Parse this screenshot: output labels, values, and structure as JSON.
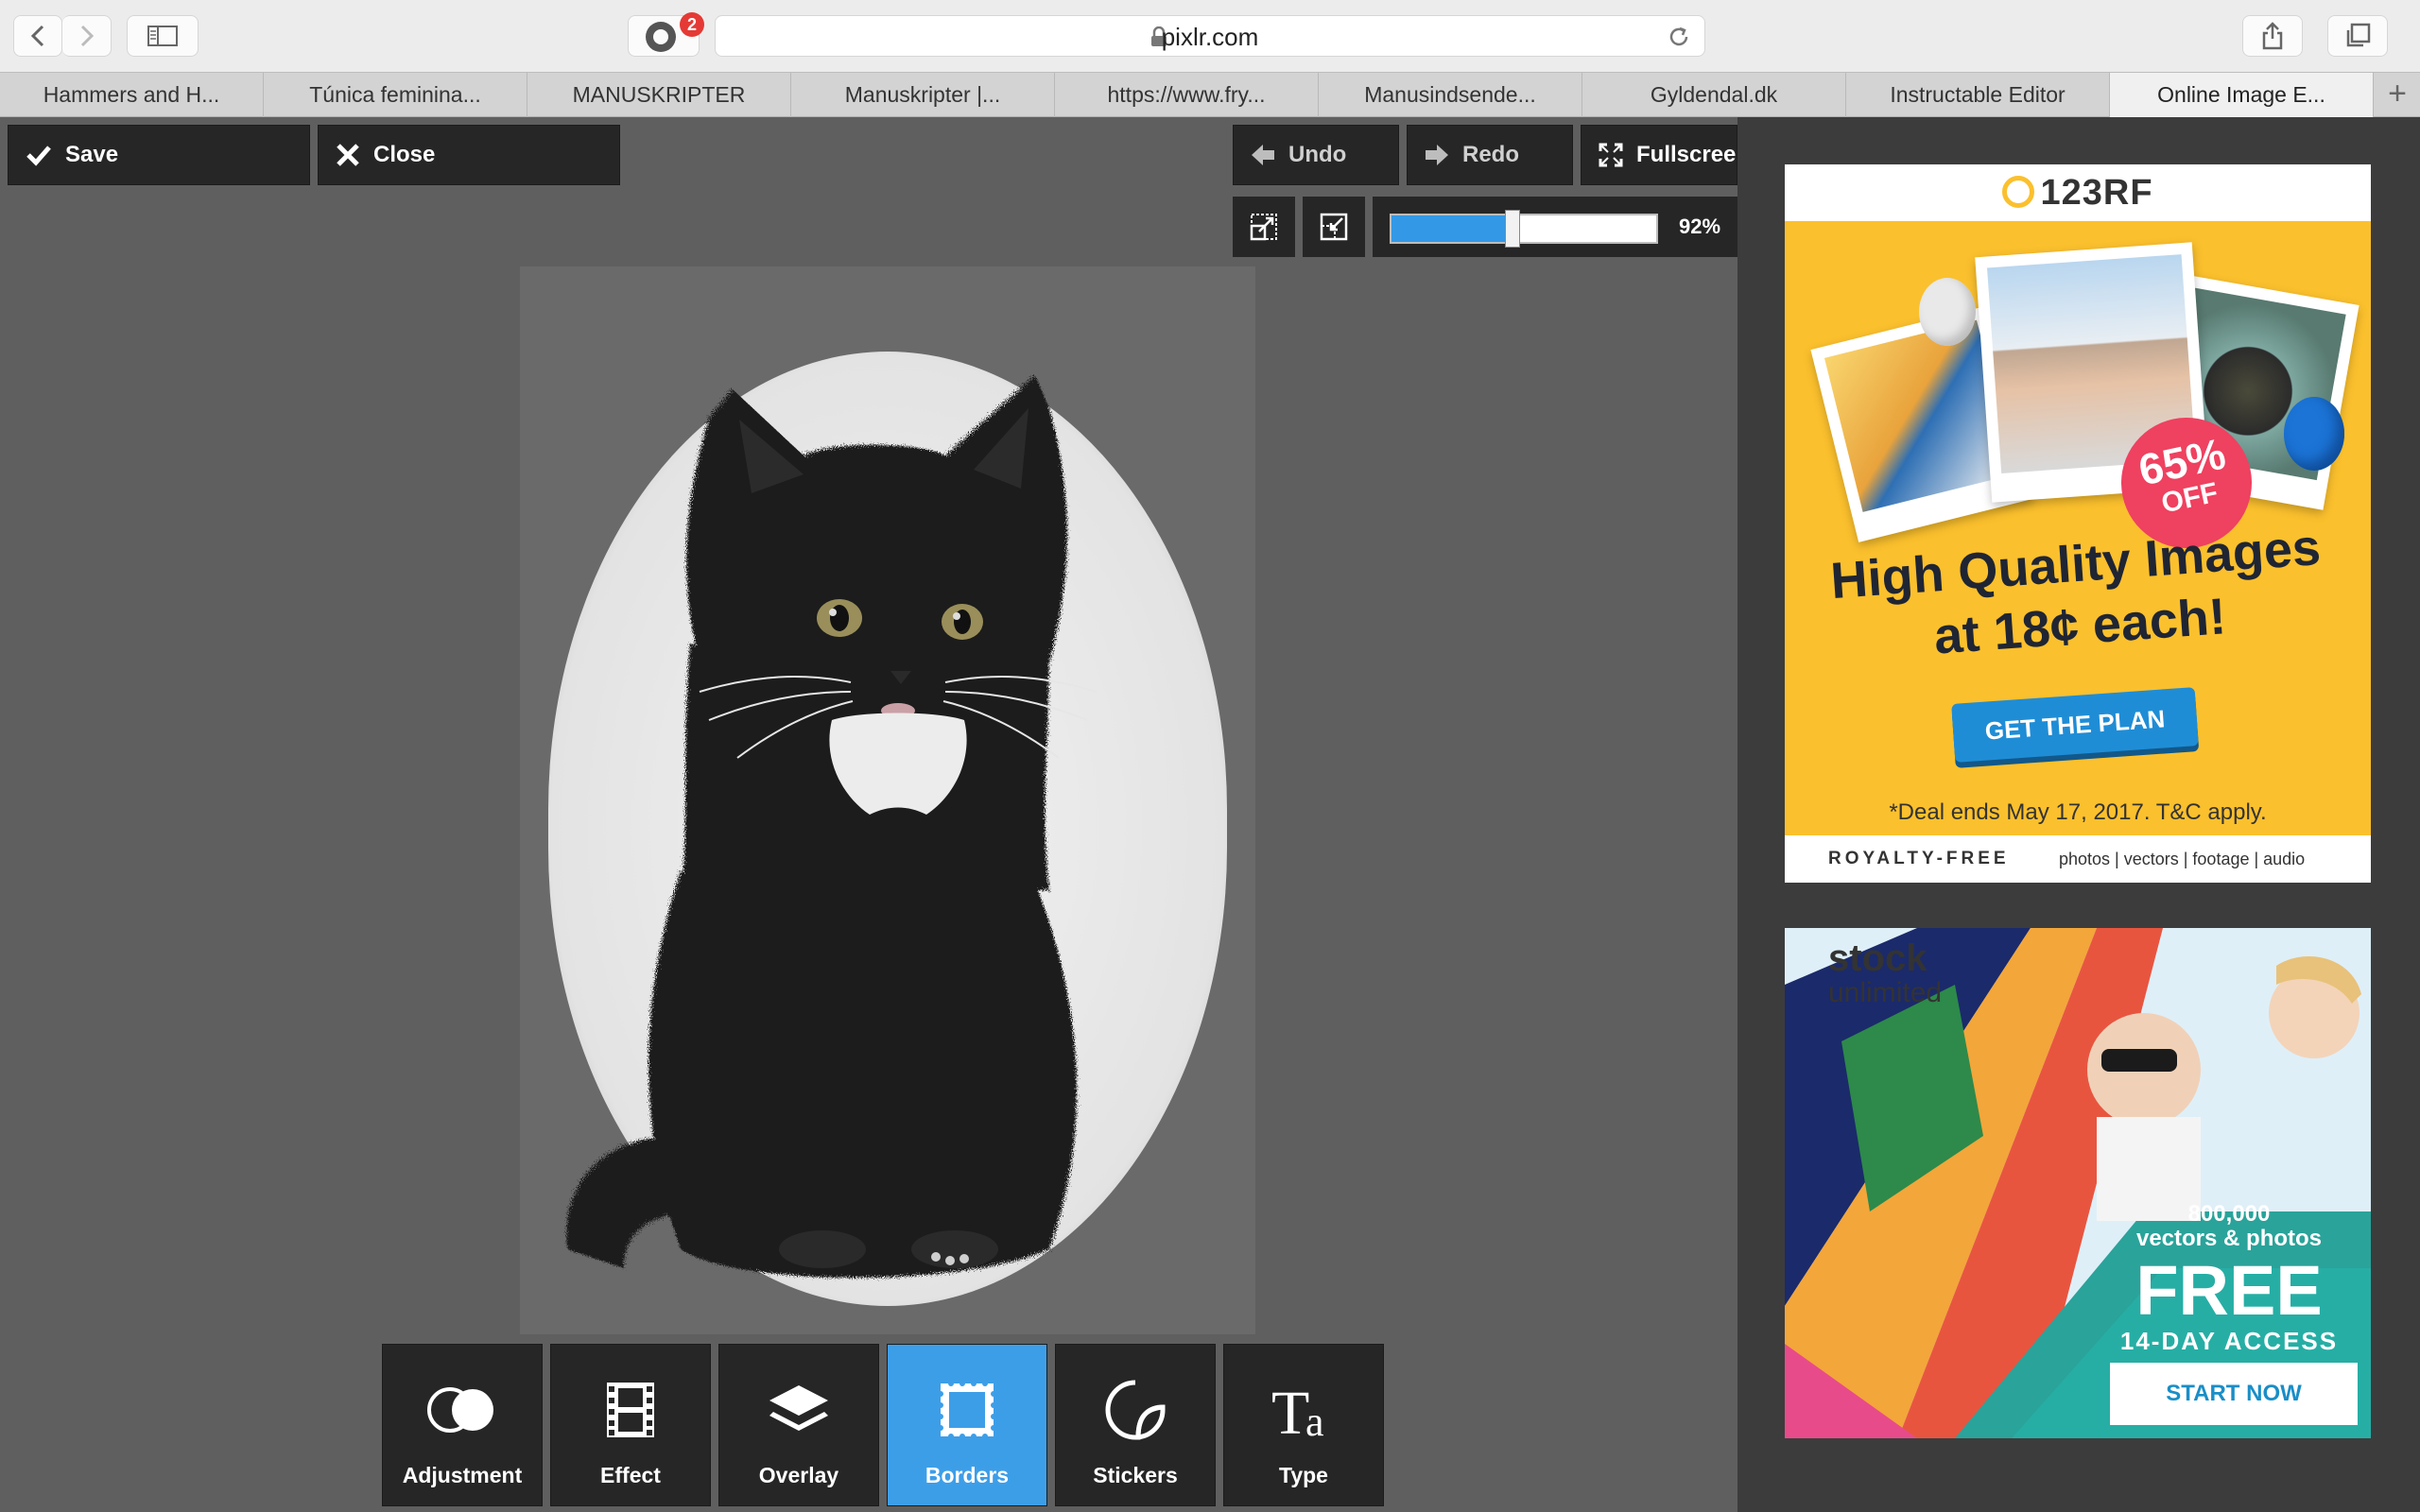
{
  "browser": {
    "url": "pixlr.com",
    "extension_badge": "2",
    "tabs": [
      {
        "label": "Hammers and H..."
      },
      {
        "label": "Túnica feminina..."
      },
      {
        "label": "MANUSKRIPTER"
      },
      {
        "label": "Manuskripter |..."
      },
      {
        "label": "https://www.fry..."
      },
      {
        "label": "Manusindsende..."
      },
      {
        "label": "Gyldendal.dk"
      },
      {
        "label": "Instructable Editor"
      },
      {
        "label": "Online Image E...",
        "active": true
      }
    ]
  },
  "editor": {
    "save_label": "Save",
    "close_label": "Close",
    "undo_label": "Undo",
    "redo_label": "Redo",
    "fullscreen_label": "Fullscreen",
    "zoom_value": 0.45,
    "zoom_label": "92%",
    "canvas_image": "black-and-white-kitten",
    "tools": [
      {
        "label": "Adjustment",
        "icon": "adjustment-icon"
      },
      {
        "label": "Effect",
        "icon": "film-icon"
      },
      {
        "label": "Overlay",
        "icon": "layers-icon"
      },
      {
        "label": "Borders",
        "icon": "border-frame-icon",
        "active": true
      },
      {
        "label": "Stickers",
        "icon": "sticker-icon"
      },
      {
        "label": "Type",
        "icon": "type-icon"
      }
    ]
  },
  "ads": {
    "ad1": {
      "brand": "123RF",
      "badge_pct": "65%",
      "badge_word": "OFF",
      "headline_1": "High Quality Images",
      "headline_2": "at 18¢ each!",
      "cta": "GET THE PLAN",
      "deal": "*Deal ends May 17, 2017. T&C apply.",
      "footer_left": "ROYALTY-FREE",
      "footer_right": "photos | vectors | footage | audio"
    },
    "ad2": {
      "brand_1": "stock",
      "brand_2": "unlimited",
      "count": "800,000",
      "count_sub": "vectors & photos",
      "free": "FREE",
      "access": "14-DAY ACCESS",
      "cta": "START NOW"
    }
  },
  "colors": {
    "accent": "#3d9ee8",
    "editor_bg": "#5f5f5f",
    "button_bg": "#262626",
    "ad_yellow": "#fbc02d"
  }
}
